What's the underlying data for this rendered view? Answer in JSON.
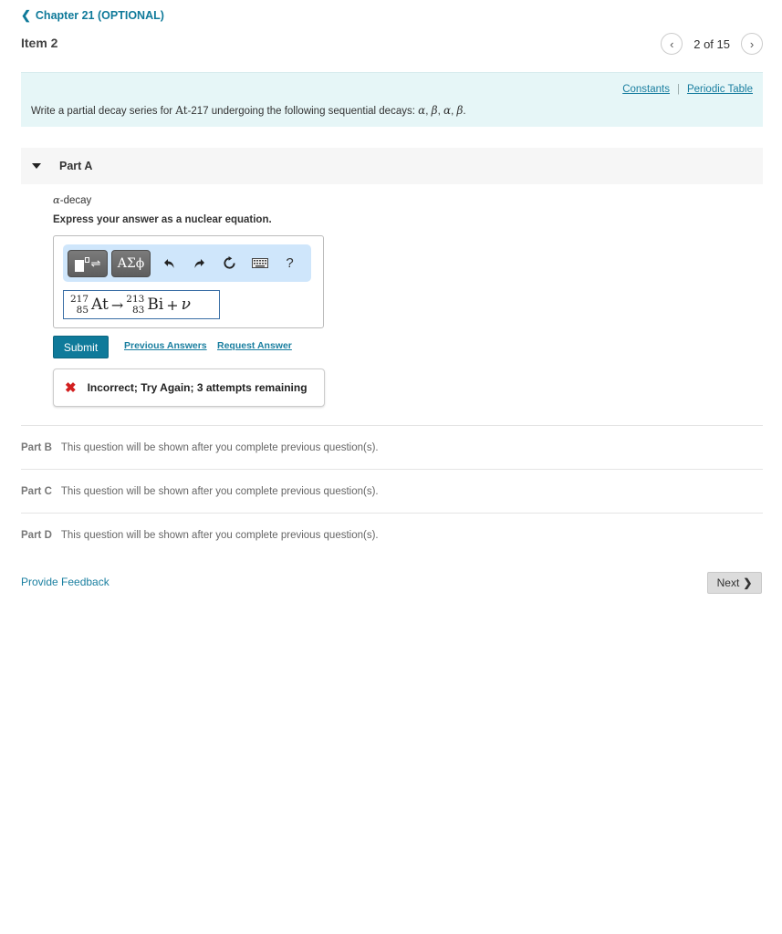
{
  "header": {
    "back_link": "Chapter 21 (OPTIONAL)",
    "item_title": "Item 2",
    "pager": {
      "current_text": "2 of 15",
      "prev_icon": "‹",
      "next_icon": "›"
    }
  },
  "intro": {
    "links": {
      "constants": "Constants",
      "separator": "|",
      "periodic_table": "Periodic Table"
    },
    "prompt_prefix": "Write a partial decay series for ",
    "prompt_element": "At",
    "prompt_middle": "-217 undergoing the following sequential decays: ",
    "decays": [
      "α",
      "β",
      "α",
      "β"
    ],
    "bg_color": "#e6f6f7"
  },
  "partA": {
    "label": "Part A",
    "decay_symbol": "α",
    "decay_suffix": "-decay",
    "instruction": "Express your answer as a nuclear equation.",
    "toolbar": {
      "templates_icon": "⇌",
      "greek_label": "ΑΣϕ",
      "undo_icon": "↶",
      "redo_icon": "↷",
      "reset_icon": "↻",
      "keyboard_icon": "⌨",
      "help_label": "?"
    },
    "answer": {
      "reactant": {
        "mass": "217",
        "atomic": "85",
        "symbol": "At"
      },
      "arrow": "→",
      "product": {
        "mass": "213",
        "atomic": "83",
        "symbol": "Bi"
      },
      "plus": "+",
      "extra": "ν"
    },
    "submit_label": "Submit",
    "previous_answers_label": "Previous Answers",
    "request_answer_label": "Request Answer",
    "feedback": {
      "icon": "✖",
      "message": "Incorrect; Try Again; 3 attempts remaining",
      "icon_color": "#d21f1f"
    }
  },
  "locked_parts": [
    {
      "label": "Part B",
      "text": "This question will be shown after you complete previous question(s)."
    },
    {
      "label": "Part C",
      "text": "This question will be shown after you complete previous question(s)."
    },
    {
      "label": "Part D",
      "text": "This question will be shown after you complete previous question(s)."
    }
  ],
  "footer": {
    "provide_feedback": "Provide Feedback",
    "next_label": "Next",
    "next_icon": "❯"
  },
  "colors": {
    "accent": "#0f7a9a",
    "link": "#1a7fa0"
  }
}
